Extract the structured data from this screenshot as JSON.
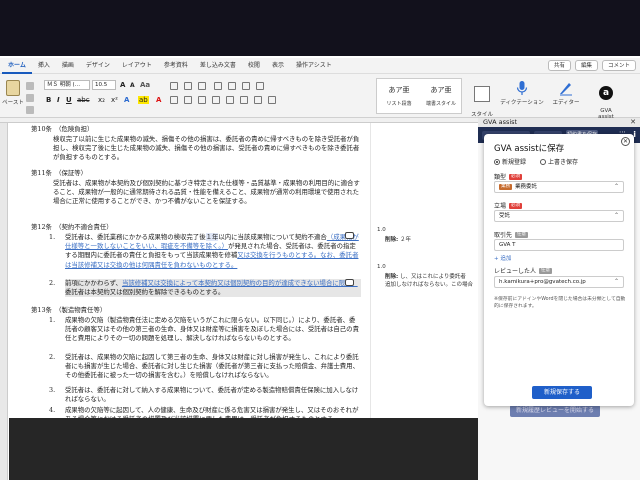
{
  "ribbon_tabs": [
    {
      "label": "ホーム",
      "active": true
    },
    {
      "label": "挿入"
    },
    {
      "label": "描画"
    },
    {
      "label": "デザイン"
    },
    {
      "label": "レイアウト"
    },
    {
      "label": "参考資料"
    },
    {
      "label": "差し込み文書"
    },
    {
      "label": "校閲"
    },
    {
      "label": "表示"
    },
    {
      "label": "操作アシスト"
    }
  ],
  "ribbon_right": {
    "share": "共有",
    "edit": "編集",
    "comment": "コメント"
  },
  "ribbon": {
    "paste_label": "ペースト",
    "font_name": "ＭＳ 明朝 (…",
    "font_size": "10.5",
    "style1_preview": "あア亜",
    "style1_label": "リスト段落",
    "style2_preview": "あア亜",
    "style2_label": "端書スタイル",
    "styles_pane": "スタイル\nウィンドウ",
    "dictation": "ディクテーション",
    "editor": "エディター",
    "gva_assist": "GVA\nassist",
    "icon_colors": {
      "editor": "#2f6ed3",
      "gva": "#111111"
    }
  },
  "document": {
    "p10_head": "第10条　（危険負担）",
    "p10_body": "検収完了以前に生じた成果物の滅失、損傷その他の損害は、委託者の責めに帰すべきものを除き受託者が負担し、検収完了後に生じた成果物の滅失、損傷その他の損害は、受託者の責めに帰すべきものを除き委託者が負担するものとする。",
    "p11_head": "第11条　（保証等）",
    "p11_body": "受託者は、成果物が本契約及び個別契約に基づき特定された仕様等・品質基準・成果物の利用目的に適合すること、成果物が一般的に通常期待される品質・性能を備えること、成果物が通常の利用環境で使用された場合に正常に使用することができ、かつ不備がないことを保証する。",
    "p12_head": "第12条　（契約不適合責任）",
    "p12_item1_num": "1.",
    "p12_item1_a": "受託者は、委託業務にかかる成果物の検収完了後",
    "p12_item1_hl": "１年",
    "p12_item1_b": "以内に当該成果物について契約不適合",
    "p12_item1_ins1": "（成果物が仕様等と一致しないことをいい、瑕疵を不備等を除く。）",
    "p12_item1_c": "が発見された場合、受託者は、委託者の指定する期間内に委託者の責任と負担をもって当該成果物を修補",
    "p12_item1_ins2": "又は交換を行うものとする。なお、委託者は当該修補又は交換の他は何隅責任を負わないものとする。",
    "p12_item2_num": "2.",
    "p12_item2_a": "前項にかかわらず、",
    "p12_item2_ins": "当該修補又は交換によって本契約又は個別契約の目的が達成できない場合に限り、",
    "p12_item2_b": "委託者は本契約又は個別契約を解除できるものとする。",
    "p13_head": "第13条　（製造物責任等）",
    "p13_item1_num": "1.",
    "p13_item1": "成果物の欠陥（製造物責任法に定める欠陥をいうがこれに限らない。以下同じ。）により、委託者、委託者の顧客又はその他の第三者の生命、身体又は財産等に損害を及ぼした場合には、受託者は自己の責任と費用によりその一切の問題を処理し、解決しなければならないものとする。",
    "p13_item2_num": "2.",
    "p13_item2": "受託者は、成果物の欠陥に起因して第三者の生命、身体又は財産に対し損害が発生し、これにより委託者にも損害が生じた場合、委託者に対し生じた損害（委託者が第三者に支払った賠償金、弁護士費用、その他委託者に被った一切の損害を含む。）を賠償しなければならない。",
    "p13_item3_num": "3.",
    "p13_item3": "受託者は、委託者に対して納入する成果物について、委託者が定める製造物賠償責任保険に加入しなければならない。",
    "p13_item4_num": "4.",
    "p13_item4": "成果物の欠陥等に起因して、人の健康、生命及び財産に係る危害又は損害が発生し、又はそのおそれがある場合等における受託者の措置及び当該措置に要した費用は、受託者が負担するものとする。"
  },
  "changes": {
    "c1_num": "1.0",
    "c1_label": "削除:",
    "c1_text": "２年",
    "c2_num": "1.0",
    "c2_label": "削除:",
    "c2_text": "し、又はこれにより委託者",
    "c2_text2": "追加しなければならない。この場合"
  },
  "pane": {
    "title": "GVA assist",
    "toolbar_save": "契約書を保存"
  },
  "modal": {
    "title": "GVA assistに保存",
    "radio_new": "新規登録",
    "radio_overwrite": "上書き保存",
    "type_label": "類型",
    "required": "必須",
    "type_tag": "業務",
    "type_value": "業務委託",
    "stance_label": "立場",
    "stance_value": "受託",
    "party_label": "取引先",
    "optional": "任意",
    "party_value": "GVA T",
    "add": "+ 追加",
    "reviewer_label": "レビューした人",
    "reviewer_value": "h.kamikura+pro@gvatech.co.jp",
    "note": "※保存前にアドインやWordを閉じた場合は未分類として自動的に保存されます。",
    "save_button": "新規保存する"
  },
  "ghost_button": "新規履歴レビューを開始する"
}
